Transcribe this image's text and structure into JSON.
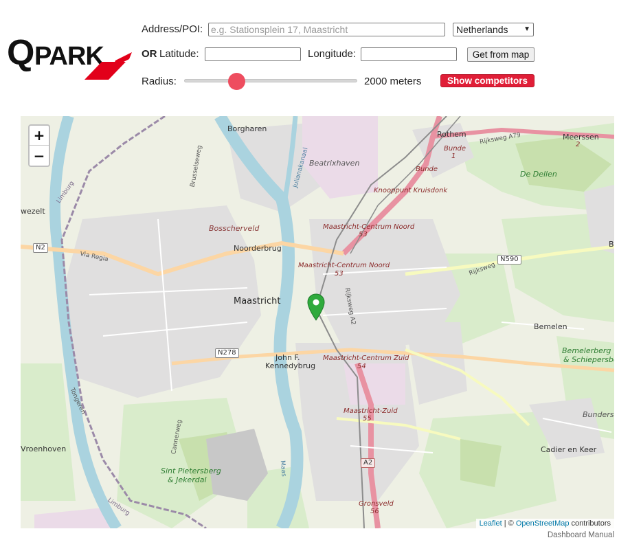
{
  "logo": {
    "text": "QPARK",
    "brand_red": "#e2001a"
  },
  "form": {
    "address_label": "Address/POI:",
    "address_placeholder": "e.g. Stationsplein 17, Maastricht",
    "address_value": "",
    "country_selected": "Netherlands",
    "or_label": "OR",
    "latitude_label": "Latitude:",
    "latitude_value": "",
    "longitude_label": "Longitude:",
    "longitude_value": "",
    "get_from_map_label": "Get from map",
    "radius_label": "Radius:",
    "radius_value": "2000 meters",
    "radius_slider_fraction": 0.28,
    "show_competitors_label": "Show competitors"
  },
  "map": {
    "zoom_in": "+",
    "zoom_out": "−",
    "marker_color": "#2faa3c",
    "labels": {
      "borgharen": "Borgharen",
      "beatrixhaven": "Beatrixhaven",
      "rothem": "Rothem",
      "meerssen": "Meerssen",
      "meerssen_num": "2",
      "bunde": "Bunde",
      "bunde_num": "1",
      "bunde2": "Bunde",
      "knooppunt": "Knooppunt Kruisdonk",
      "de_dellen": "De Dellen",
      "wezelt": "wezelt",
      "limburg_top": "Limburg",
      "bosscherveld": "Bosscherveld",
      "noorderbrug": "Noorderbrug",
      "mcn": "Maastricht-Centrum Noord",
      "mcn_num": "53",
      "mcn2": "Maastricht-Centrum Noord",
      "mcn2_num": "53",
      "maastricht": "Maastricht",
      "via_regia": "Via Regia",
      "n2": "N2",
      "n590": "N590",
      "rijksweg": "Rijksweg",
      "rijksweg_a79": "Rijksweg A79",
      "bemelen": "Bemelen",
      "bemelerberg": "Bemelerberg",
      "schiepersberg": "& Schiepersber",
      "n278": "N278",
      "jfk_1": "John F.",
      "jfk_2": "Kennedybrug",
      "mcz": "Maastricht-Centrum Zuid",
      "mcz_num": "54",
      "mz": "Maastricht-Zuid",
      "mz_num": "55",
      "tongeren": "Tongeren",
      "vroenhoven": "Vroenhoven",
      "sint_pietersberg_1": "Sint Pietersberg",
      "sint_pietersberg_2": "& Jekerdal",
      "a2": "A2",
      "gronsveld": "Gronsveld",
      "gronsveld_num": "56",
      "cadier": "Cadier en Keer",
      "bundersbe": "Bundersbe",
      "limburg_bottom": "Limburg",
      "maas": "Maas",
      "cannerweg": "Cannerweg",
      "brusselseweg": "Brusselseweg",
      "julianakanaal": "Julianakanaal",
      "b_edge": "B",
      "rijksweg_a2": "Rijksweg A2"
    },
    "attribution_leaflet": "Leaflet",
    "attribution_sep": " | © ",
    "attribution_osm": "OpenStreetMap",
    "attribution_tail": " contributors"
  },
  "footer": {
    "dashboard_manual": "Dashboard Manual"
  }
}
